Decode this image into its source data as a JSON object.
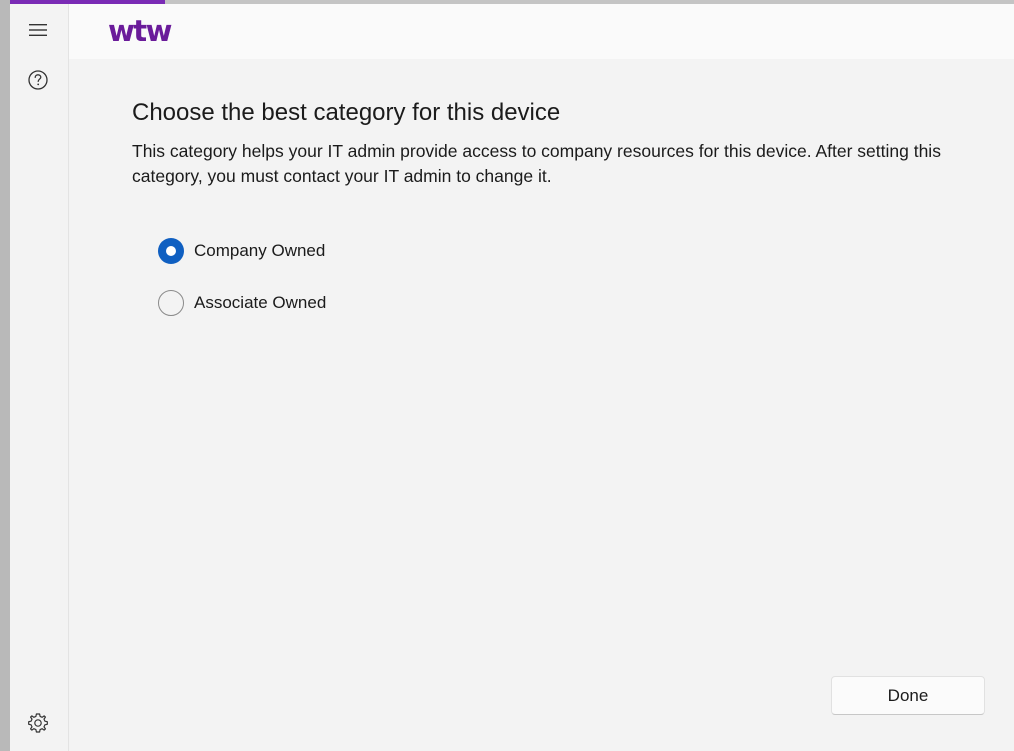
{
  "header": {
    "logo_text": "wtw"
  },
  "nav": {
    "menu_icon": "hamburger-menu-icon",
    "help_icon": "help-circle-icon",
    "settings_icon": "gear-icon"
  },
  "main": {
    "title": "Choose the best category for this device",
    "description": "This category helps your IT admin provide access to company resources for this device. After setting this category, you must contact your IT admin to change it.",
    "options": [
      {
        "label": "Company Owned",
        "checked": true
      },
      {
        "label": "Associate Owned",
        "checked": false
      }
    ],
    "done_label": "Done"
  },
  "colors": {
    "accent": "#0f5fc1",
    "brand": "#6a1b9a",
    "top_accent": "#7a2bb5"
  }
}
